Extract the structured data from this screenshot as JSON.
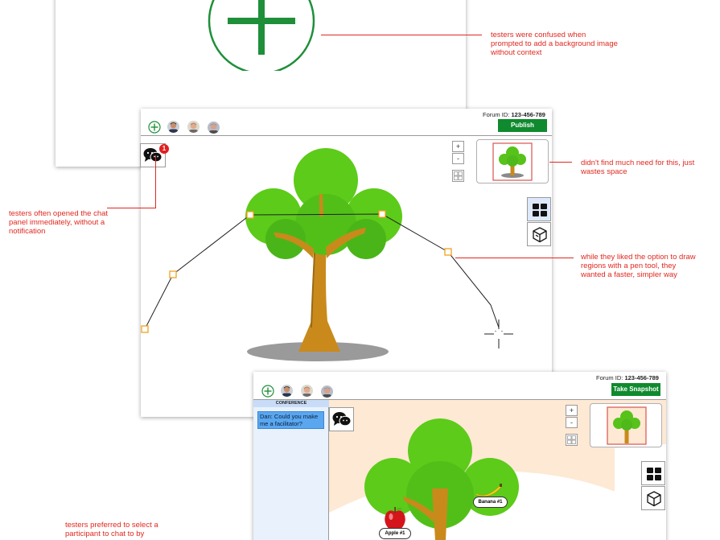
{
  "annotations": {
    "background_image": "testers were confused when prompted to add a background image without context",
    "minimap": "didn't find much need for this, just wastes space",
    "chat_notification": "testers often opened the chat panel immediately, without a notification",
    "pen_tool": "while they liked the option to draw regions with a pen tool, they wanted a faster, simpler way",
    "participant_select": "testers preferred to select a participant to chat to by"
  },
  "screen1": {
    "forum_label": "Forum ID:",
    "forum_id": "123-456-789",
    "publish_label": "Publish",
    "zoom_in": "+",
    "zoom_out": "-",
    "chat_badge": "1"
  },
  "screen2": {
    "forum_label": "Forum ID:",
    "forum_id": "123-456-789",
    "snapshot_label": "Take Snapshot",
    "zoom_in": "+",
    "zoom_out": "-",
    "conference_header": "CONFERENCE",
    "chat_message": "Dan: Could you make me a facilitator?",
    "banana_label": "Banana #1",
    "apple_label": "Apple #1"
  },
  "colors": {
    "accent_green": "#0f8a2e",
    "annotation_red": "#e0281f",
    "handle_orange": "#f0a020",
    "panel_blue": "#dde9fb"
  }
}
